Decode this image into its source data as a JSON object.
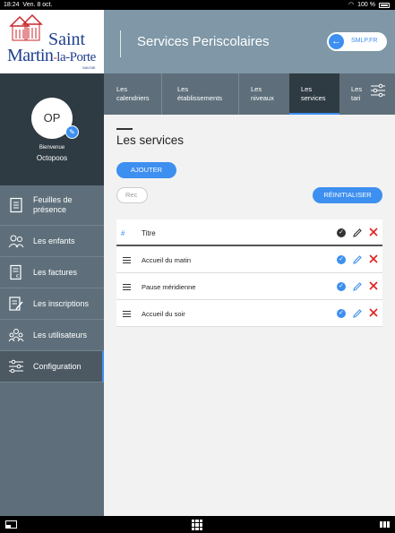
{
  "status_bar": {
    "time": "18:24",
    "date": "Ven. 8 oct.",
    "battery": "100 %"
  },
  "header": {
    "logo": {
      "line1": "Saint",
      "line2_a": "Martin",
      "line2_b": "la-Porte",
      "line3": "SAVOIE"
    },
    "title": "Services Periscolaires",
    "smlp_link": "SMLP.FR"
  },
  "profile": {
    "initials": "OP",
    "welcome": "Bienvenue",
    "name": "Octopoos"
  },
  "sidebar": {
    "items": [
      {
        "label": "Feuilles de présence",
        "icon": "attendance-sheet-icon"
      },
      {
        "label": "Les enfants",
        "icon": "children-icon"
      },
      {
        "label": "Les factures",
        "icon": "invoice-icon"
      },
      {
        "label": "Les inscriptions",
        "icon": "registration-icon"
      },
      {
        "label": "Les utilisateurs",
        "icon": "users-icon"
      },
      {
        "label": "Configuration",
        "icon": "sliders-icon",
        "active": true
      }
    ]
  },
  "tabs": [
    {
      "line1": "Les",
      "line2": "calendriers"
    },
    {
      "line1": "Les",
      "line2": "établissements"
    },
    {
      "line1": "Les",
      "line2": "niveaux"
    },
    {
      "line1": "Les",
      "line2": "services",
      "active": true
    },
    {
      "line1": "Les",
      "line2": "tari"
    }
  ],
  "main": {
    "title": "Les services",
    "add_button": "AJOUTER",
    "search_placeholder": "Rec",
    "reset_button": "RÉINITIALISER",
    "table": {
      "header": {
        "hash": "#",
        "title": "Titre"
      },
      "rows": [
        {
          "title": "Accueil du matin"
        },
        {
          "title": "Pause méridienne"
        },
        {
          "title": "Accueil du soir"
        }
      ]
    }
  },
  "colors": {
    "accent": "#3d8ff0",
    "sidebar": "#5e6f7b",
    "dark": "#2f3b43",
    "header": "#7f97a6",
    "delete": "#e02020"
  }
}
